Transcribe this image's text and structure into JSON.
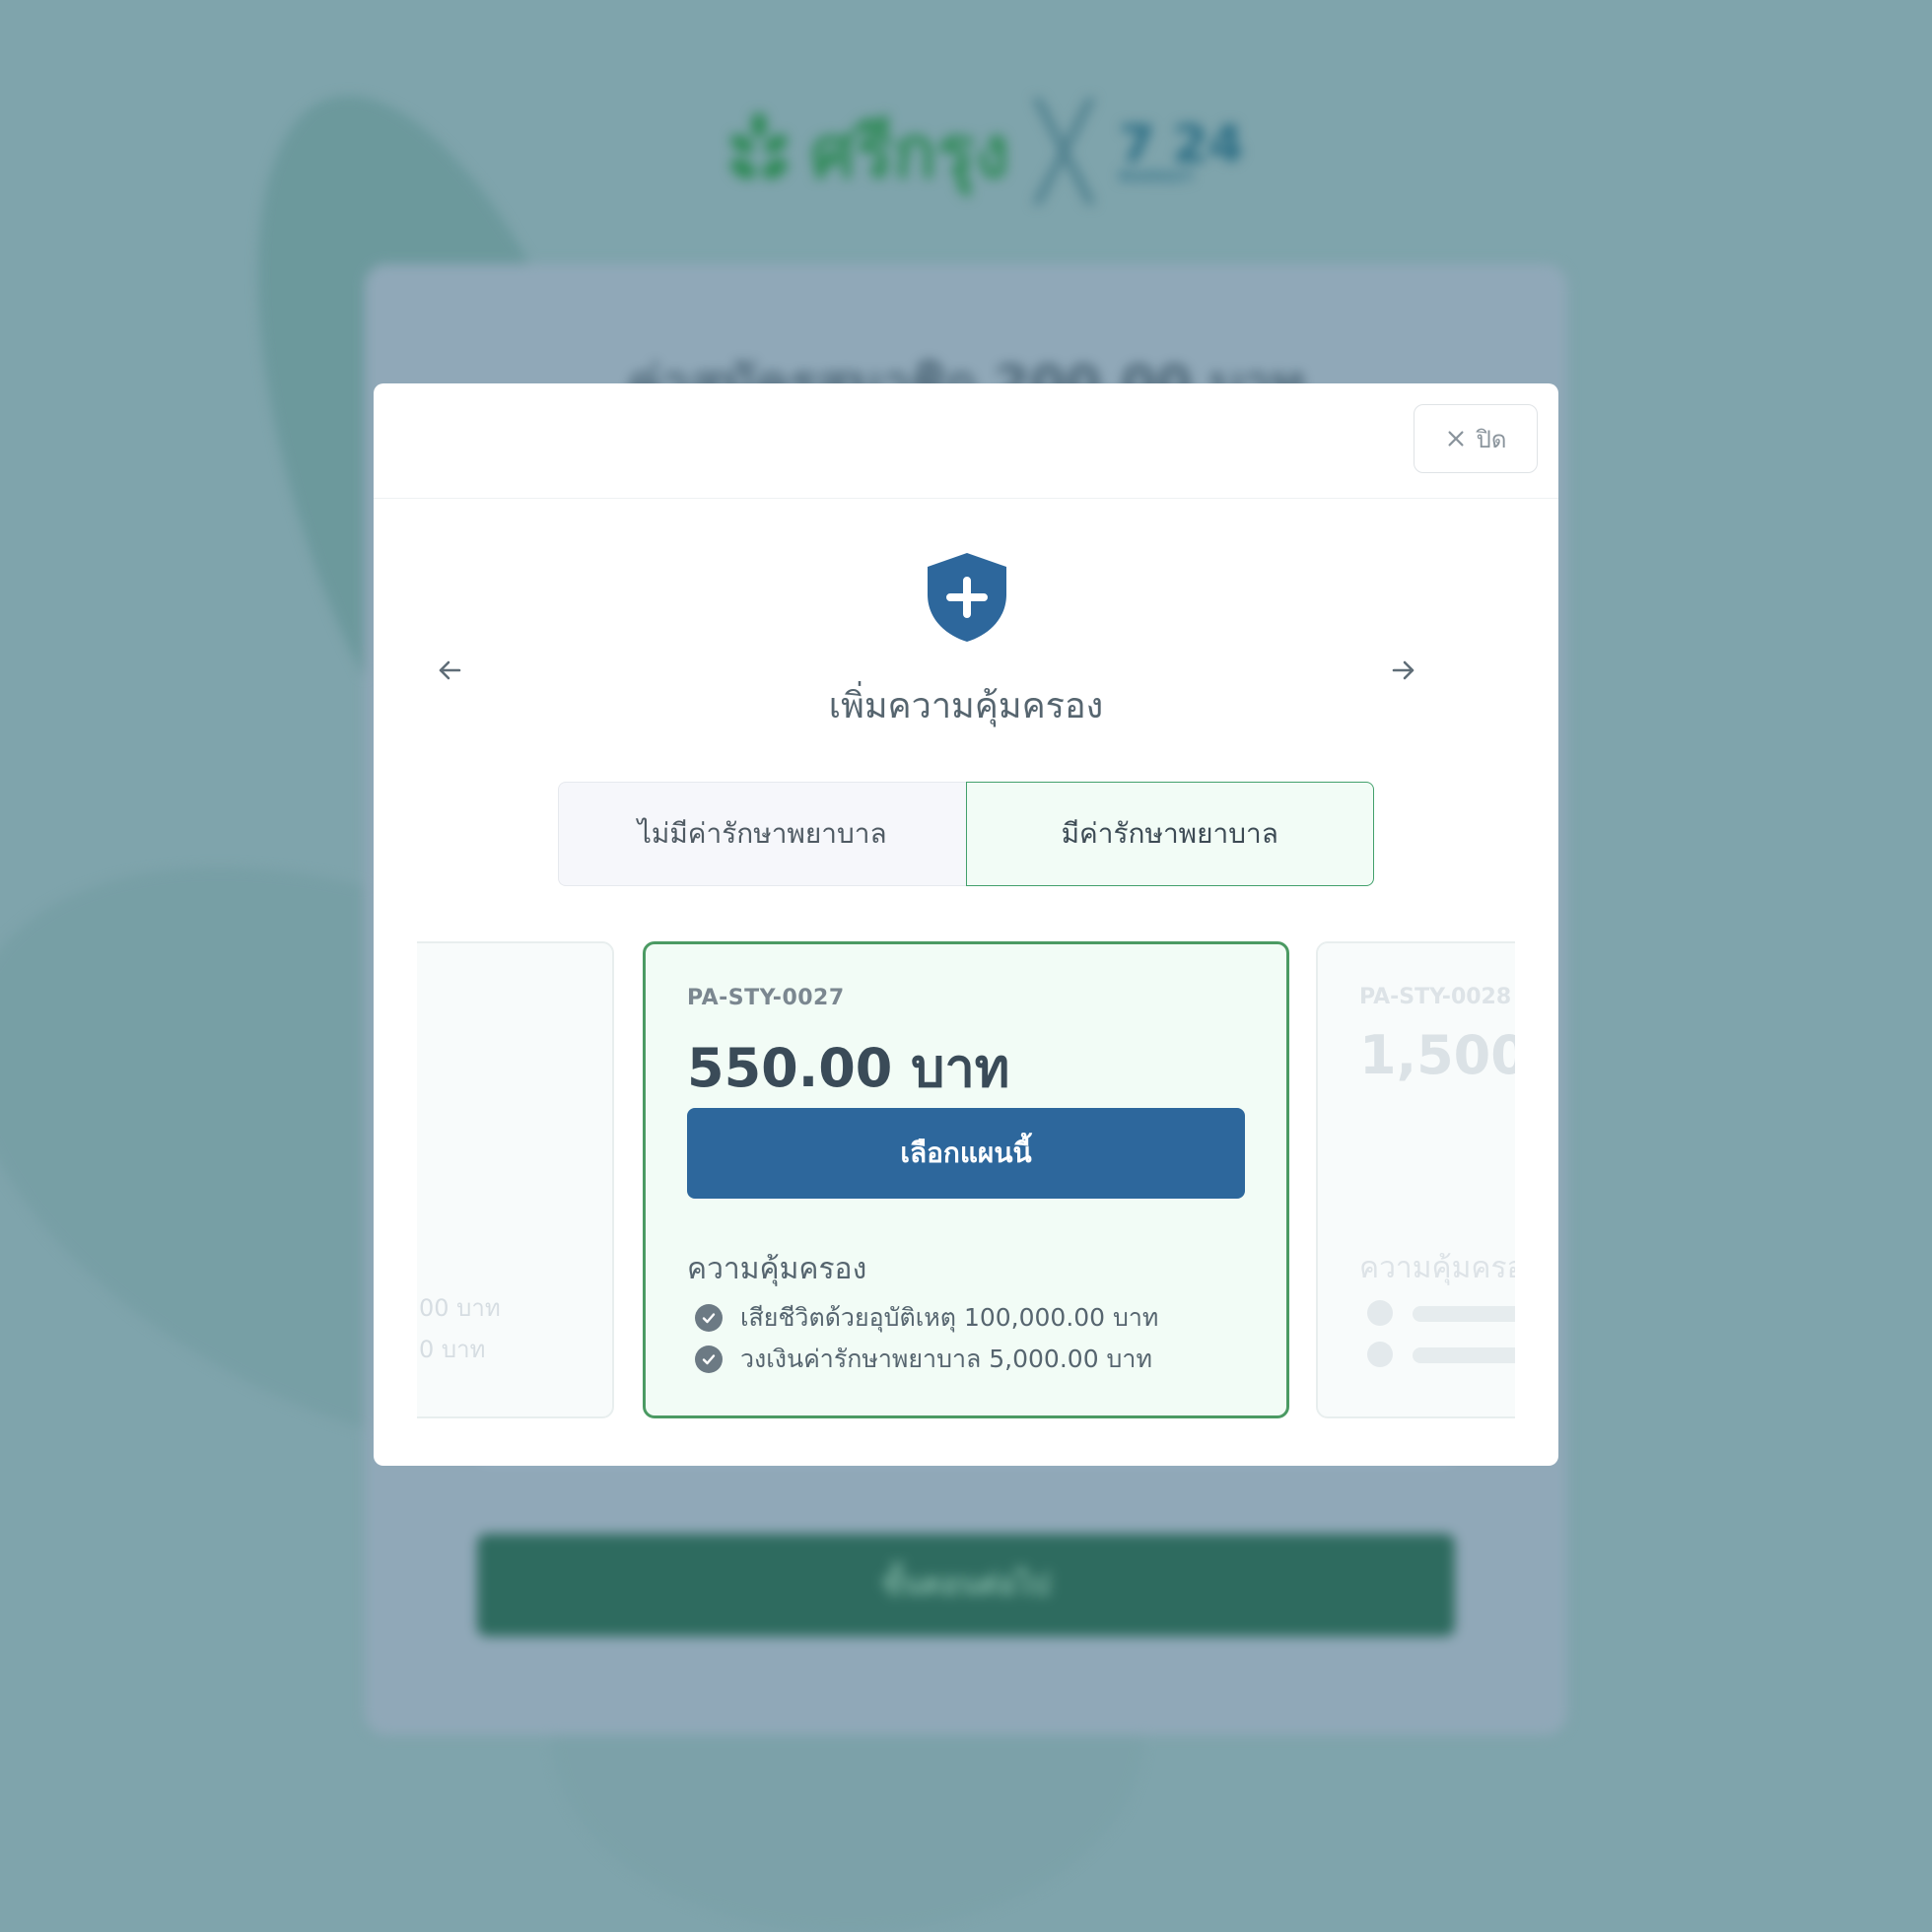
{
  "background": {
    "brand": {
      "name": "ศรีกรุง",
      "partner_top": "7 24",
      "partner_bottom": "MARKET"
    },
    "fee_title": "ค่าสมัครสมาชิก 200.00 บาท",
    "next_button": "ขั้นตอนต่อไป"
  },
  "modal": {
    "close_label": "ปิด",
    "title": "เพิ่มความคุ้มครอง",
    "tabs": [
      {
        "label": "ไม่มีค่ารักษาพยาบาล",
        "active": false
      },
      {
        "label": "มีค่ารักษาพยาบาล",
        "active": true
      }
    ],
    "plan": {
      "code": "PA-STY-0027",
      "price": "550.00 บาท",
      "select_label": "เลือกแผนนี้",
      "coverage_title": "ความคุ้มครอง",
      "coverage_items": [
        "เสียชีวิตด้วยอุบัติเหตุ 100,000.00 บาท",
        "วงเงินค่ารักษาพยาบาล 5,000.00 บาท"
      ]
    },
    "next_plan": {
      "code": "PA-STY-0028",
      "price": "1,500.",
      "coverage_title": "ความคุ้มครอง"
    },
    "prev_plan": {
      "line1": "00 บาท",
      "line2": "0 บาท"
    }
  },
  "colors": {
    "primary_button": "#2d679c",
    "active_tab_border": "#43a06c",
    "selected_card_border": "#4b9a63",
    "brand_green": "#2f8a57"
  },
  "icons": [
    "shield-plus-icon",
    "close-icon",
    "arrow-left-icon",
    "arrow-right-icon",
    "check-circle-icon"
  ]
}
